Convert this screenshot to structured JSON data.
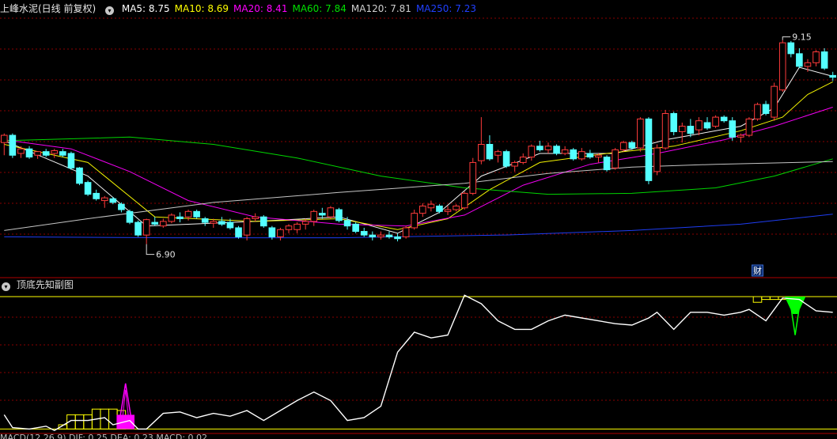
{
  "header": {
    "stock_label": "上峰水泥(日线 前复权)",
    "ma": [
      {
        "name": "MA5",
        "value": "8.75",
        "color": "#ffffff"
      },
      {
        "name": "MA10",
        "value": "8.69",
        "color": "#ffff00"
      },
      {
        "name": "MA20",
        "value": "8.41",
        "color": "#ff00ff"
      },
      {
        "name": "MA60",
        "value": "7.84",
        "color": "#00e000"
      },
      {
        "name": "MA120",
        "value": "7.81",
        "color": "#cfcfcf"
      },
      {
        "name": "MA250",
        "value": "7.23",
        "color": "#2040ff"
      }
    ]
  },
  "indicator": {
    "title": "顶底先知副图",
    "bottom_label": "MACD(12,26,9) DIF: 0.25 DEA: 0.23 MACD: 0.02"
  },
  "colors": {
    "up": "#ff3b3b",
    "down": "#54ffff",
    "grid": "#8a0000",
    "separator": "#b00000",
    "ref_line": "#ffff00",
    "ind_line": "#ffffff",
    "bottom_signal": "#ff00ff",
    "top_signal": "#00ff00",
    "ma250": "#2040ff"
  },
  "chart_data": [
    {
      "type": "candlestick",
      "ylim": [
        6.6,
        9.4
      ],
      "annotations": {
        "high_label": "9.15",
        "low_label": "6.90",
        "marker_label": "财"
      },
      "candles": [
        [
          8.02,
          8.12,
          7.88,
          8.1
        ],
        [
          8.1,
          8.12,
          7.85,
          7.88
        ],
        [
          7.9,
          7.98,
          7.85,
          7.95
        ],
        [
          7.95,
          7.98,
          7.84,
          7.86
        ],
        [
          7.88,
          7.92,
          7.84,
          7.92
        ],
        [
          7.92,
          7.95,
          7.86,
          7.88
        ],
        [
          7.9,
          7.95,
          7.85,
          7.93
        ],
        [
          7.92,
          7.95,
          7.86,
          7.88
        ],
        [
          7.9,
          7.92,
          7.72,
          7.74
        ],
        [
          7.74,
          7.75,
          7.55,
          7.57
        ],
        [
          7.58,
          7.6,
          7.43,
          7.45
        ],
        [
          7.46,
          7.5,
          7.38,
          7.4
        ],
        [
          7.38,
          7.43,
          7.3,
          7.41
        ],
        [
          7.4,
          7.42,
          7.34,
          7.36
        ],
        [
          7.34,
          7.36,
          7.25,
          7.28
        ],
        [
          7.26,
          7.28,
          7.12,
          7.14
        ],
        [
          7.14,
          7.16,
          6.98,
          7.0
        ],
        [
          7.0,
          7.18,
          6.9,
          7.17
        ],
        [
          7.14,
          7.2,
          7.1,
          7.12
        ],
        [
          7.1,
          7.18,
          7.08,
          7.15
        ],
        [
          7.15,
          7.24,
          7.13,
          7.22
        ],
        [
          7.2,
          7.25,
          7.14,
          7.18
        ],
        [
          7.2,
          7.28,
          7.16,
          7.26
        ],
        [
          7.26,
          7.28,
          7.18,
          7.2
        ],
        [
          7.18,
          7.2,
          7.1,
          7.14
        ],
        [
          7.13,
          7.18,
          7.08,
          7.15
        ],
        [
          7.15,
          7.2,
          7.1,
          7.12
        ],
        [
          7.14,
          7.18,
          7.06,
          7.08
        ],
        [
          7.08,
          7.1,
          6.96,
          6.98
        ],
        [
          7.0,
          7.2,
          6.94,
          7.18
        ],
        [
          7.18,
          7.24,
          7.15,
          7.2
        ],
        [
          7.2,
          7.22,
          7.08,
          7.1
        ],
        [
          7.08,
          7.1,
          6.95,
          6.98
        ],
        [
          6.98,
          7.08,
          6.94,
          7.06
        ],
        [
          7.06,
          7.12,
          7.02,
          7.1
        ],
        [
          7.06,
          7.14,
          7.02,
          7.12
        ],
        [
          7.12,
          7.18,
          7.06,
          7.15
        ],
        [
          7.15,
          7.28,
          7.1,
          7.26
        ],
        [
          7.24,
          7.3,
          7.18,
          7.22
        ],
        [
          7.2,
          7.32,
          7.18,
          7.3
        ],
        [
          7.28,
          7.3,
          7.14,
          7.16
        ],
        [
          7.16,
          7.2,
          7.06,
          7.1
        ],
        [
          7.12,
          7.14,
          7.02,
          7.04
        ],
        [
          7.04,
          7.08,
          6.98,
          7.0
        ],
        [
          7.0,
          7.04,
          6.94,
          6.98
        ],
        [
          6.98,
          7.04,
          6.95,
          7.0
        ],
        [
          7.0,
          7.04,
          6.96,
          6.98
        ],
        [
          6.98,
          7.02,
          6.93,
          6.96
        ],
        [
          6.98,
          7.1,
          6.96,
          7.08
        ],
        [
          7.08,
          7.28,
          7.06,
          7.24
        ],
        [
          7.24,
          7.35,
          7.2,
          7.32
        ],
        [
          7.3,
          7.38,
          7.26,
          7.34
        ],
        [
          7.32,
          7.34,
          7.24,
          7.26
        ],
        [
          7.26,
          7.32,
          7.22,
          7.28
        ],
        [
          7.28,
          7.34,
          7.26,
          7.32
        ],
        [
          7.3,
          7.48,
          7.28,
          7.46
        ],
        [
          7.46,
          7.85,
          7.44,
          7.8
        ],
        [
          7.82,
          8.3,
          7.78,
          8.0
        ],
        [
          8.0,
          8.1,
          7.82,
          7.84
        ],
        [
          7.88,
          7.94,
          7.8,
          7.92
        ],
        [
          7.92,
          7.94,
          7.74,
          7.76
        ],
        [
          7.76,
          7.82,
          7.7,
          7.8
        ],
        [
          7.8,
          7.9,
          7.78,
          7.86
        ],
        [
          7.86,
          8.0,
          7.82,
          7.98
        ],
        [
          7.98,
          8.04,
          7.92,
          7.94
        ],
        [
          7.94,
          8.02,
          7.9,
          7.98
        ],
        [
          7.98,
          8.0,
          7.88,
          7.9
        ],
        [
          7.9,
          7.98,
          7.88,
          7.94
        ],
        [
          7.94,
          7.96,
          7.82,
          7.84
        ],
        [
          7.84,
          7.96,
          7.82,
          7.92
        ],
        [
          7.9,
          7.94,
          7.84,
          7.86
        ],
        [
          7.86,
          7.9,
          7.8,
          7.88
        ],
        [
          7.86,
          7.88,
          7.7,
          7.72
        ],
        [
          7.74,
          7.96,
          7.72,
          7.94
        ],
        [
          7.94,
          8.04,
          7.92,
          8.02
        ],
        [
          8.02,
          8.04,
          7.94,
          7.96
        ],
        [
          7.96,
          8.3,
          7.92,
          8.28
        ],
        [
          8.28,
          8.3,
          7.56,
          7.6
        ],
        [
          7.7,
          8.0,
          7.66,
          7.96
        ],
        [
          7.96,
          8.38,
          7.94,
          8.34
        ],
        [
          8.34,
          8.36,
          8.1,
          8.14
        ],
        [
          8.14,
          8.24,
          8.02,
          8.2
        ],
        [
          8.2,
          8.28,
          8.08,
          8.12
        ],
        [
          8.16,
          8.3,
          8.1,
          8.26
        ],
        [
          8.24,
          8.3,
          8.16,
          8.18
        ],
        [
          8.2,
          8.32,
          8.18,
          8.3
        ],
        [
          8.3,
          8.32,
          8.24,
          8.26
        ],
        [
          8.26,
          8.3,
          8.04,
          8.08
        ],
        [
          8.08,
          8.12,
          8.02,
          8.1
        ],
        [
          8.1,
          8.3,
          8.08,
          8.28
        ],
        [
          8.28,
          8.46,
          8.26,
          8.44
        ],
        [
          8.44,
          8.48,
          8.32,
          8.34
        ],
        [
          8.3,
          8.68,
          8.26,
          8.64
        ],
        [
          8.6,
          9.15,
          8.58,
          9.12
        ],
        [
          9.12,
          9.14,
          8.96,
          9.0
        ],
        [
          9.0,
          9.06,
          8.84,
          8.86
        ],
        [
          8.86,
          8.94,
          8.8,
          8.9
        ],
        [
          8.9,
          9.04,
          8.86,
          9.02
        ],
        [
          9.02,
          9.06,
          8.82,
          8.84
        ],
        [
          8.76,
          8.8,
          8.7,
          8.74
        ]
      ],
      "ma_series": [
        {
          "name": "MA5",
          "values": [
            [
              0,
              8.04
            ],
            [
              10,
              7.65
            ],
            [
              17,
              7.1
            ],
            [
              30,
              7.15
            ],
            [
              40,
              7.2
            ],
            [
              47,
              7.02
            ],
            [
              52,
              7.25
            ],
            [
              57,
              7.65
            ],
            [
              64,
              7.9
            ],
            [
              73,
              7.9
            ],
            [
              79,
              8.05
            ],
            [
              88,
              8.2
            ],
            [
              92,
              8.4
            ],
            [
              95,
              8.85
            ],
            [
              99,
              8.75
            ]
          ]
        },
        {
          "name": "MA10",
          "values": [
            [
              0,
              8.0
            ],
            [
              10,
              7.8
            ],
            [
              18,
              7.2
            ],
            [
              30,
              7.15
            ],
            [
              40,
              7.18
            ],
            [
              47,
              7.06
            ],
            [
              53,
              7.18
            ],
            [
              58,
              7.5
            ],
            [
              64,
              7.8
            ],
            [
              72,
              7.9
            ],
            [
              80,
              7.98
            ],
            [
              88,
              8.15
            ],
            [
              93,
              8.3
            ],
            [
              96,
              8.55
            ],
            [
              99,
              8.69
            ]
          ]
        },
        {
          "name": "MA20",
          "values": [
            [
              0,
              8.05
            ],
            [
              8,
              7.95
            ],
            [
              15,
              7.7
            ],
            [
              22,
              7.38
            ],
            [
              30,
              7.2
            ],
            [
              40,
              7.12
            ],
            [
              48,
              7.1
            ],
            [
              55,
              7.22
            ],
            [
              62,
              7.55
            ],
            [
              70,
              7.78
            ],
            [
              78,
              7.9
            ],
            [
              86,
              8.05
            ],
            [
              92,
              8.2
            ],
            [
              97,
              8.35
            ],
            [
              99,
              8.41
            ]
          ]
        },
        {
          "name": "MA60",
          "values": [
            [
              0,
              8.04
            ],
            [
              15,
              8.08
            ],
            [
              25,
              8.0
            ],
            [
              35,
              7.85
            ],
            [
              45,
              7.65
            ],
            [
              55,
              7.52
            ],
            [
              65,
              7.45
            ],
            [
              75,
              7.46
            ],
            [
              85,
              7.52
            ],
            [
              92,
              7.65
            ],
            [
              99,
              7.84
            ]
          ]
        },
        {
          "name": "MA120",
          "values": [
            [
              0,
              7.05
            ],
            [
              10,
              7.18
            ],
            [
              25,
              7.36
            ],
            [
              40,
              7.47
            ],
            [
              55,
              7.57
            ],
            [
              65,
              7.68
            ],
            [
              75,
              7.75
            ],
            [
              85,
              7.78
            ],
            [
              99,
              7.81
            ]
          ]
        },
        {
          "name": "MA250",
          "values": [
            [
              0,
              6.98
            ],
            [
              20,
              6.97
            ],
            [
              40,
              6.97
            ],
            [
              60,
              7.0
            ],
            [
              75,
              7.05
            ],
            [
              88,
              7.12
            ],
            [
              99,
              7.23
            ]
          ]
        }
      ]
    },
    {
      "type": "line",
      "title": "顶底先知副图",
      "ylim": [
        0,
        100
      ],
      "ref_top": 95,
      "ref_bottom": 2,
      "values": [
        [
          0,
          12
        ],
        [
          1,
          3
        ],
        [
          3,
          2
        ],
        [
          5,
          4
        ],
        [
          6,
          1
        ],
        [
          8,
          8
        ],
        [
          10,
          8
        ],
        [
          12,
          10
        ],
        [
          13,
          5
        ],
        [
          15,
          8
        ],
        [
          16,
          2
        ],
        [
          17,
          2
        ],
        [
          19,
          13
        ],
        [
          21,
          14
        ],
        [
          23,
          10
        ],
        [
          25,
          13
        ],
        [
          27,
          11
        ],
        [
          29,
          15
        ],
        [
          31,
          8
        ],
        [
          33,
          15
        ],
        [
          35,
          22
        ],
        [
          37,
          28
        ],
        [
          39,
          22
        ],
        [
          41,
          8
        ],
        [
          43,
          10
        ],
        [
          45,
          18
        ],
        [
          47,
          56
        ],
        [
          49,
          70
        ],
        [
          51,
          66
        ],
        [
          53,
          68
        ],
        [
          55,
          96
        ],
        [
          57,
          90
        ],
        [
          59,
          78
        ],
        [
          61,
          72
        ],
        [
          63,
          72
        ],
        [
          65,
          78
        ],
        [
          67,
          82
        ],
        [
          69,
          80
        ],
        [
          71,
          78
        ],
        [
          73,
          76
        ],
        [
          75,
          75
        ],
        [
          77,
          80
        ],
        [
          78,
          84
        ],
        [
          80,
          72
        ],
        [
          82,
          84
        ],
        [
          84,
          84
        ],
        [
          86,
          82
        ],
        [
          88,
          84
        ],
        [
          89,
          86
        ],
        [
          91,
          78
        ],
        [
          93,
          94
        ],
        [
          95,
          93
        ],
        [
          97,
          85
        ],
        [
          99,
          84
        ]
      ],
      "bottom_bars": [
        [
          7,
          5
        ],
        [
          8,
          12
        ],
        [
          9,
          12
        ],
        [
          10,
          12
        ],
        [
          11,
          16
        ],
        [
          12,
          16
        ],
        [
          13,
          16
        ],
        [
          14,
          15
        ]
      ],
      "top_bars": [
        [
          89,
          95
        ],
        [
          90,
          91
        ],
        [
          91,
          93
        ],
        [
          92,
          93
        ],
        [
          93,
          93
        ]
      ],
      "bottom_signal": {
        "x": 14.5,
        "peak": 34
      },
      "top_signal": {
        "x": 94.5,
        "trough": 68
      }
    }
  ]
}
